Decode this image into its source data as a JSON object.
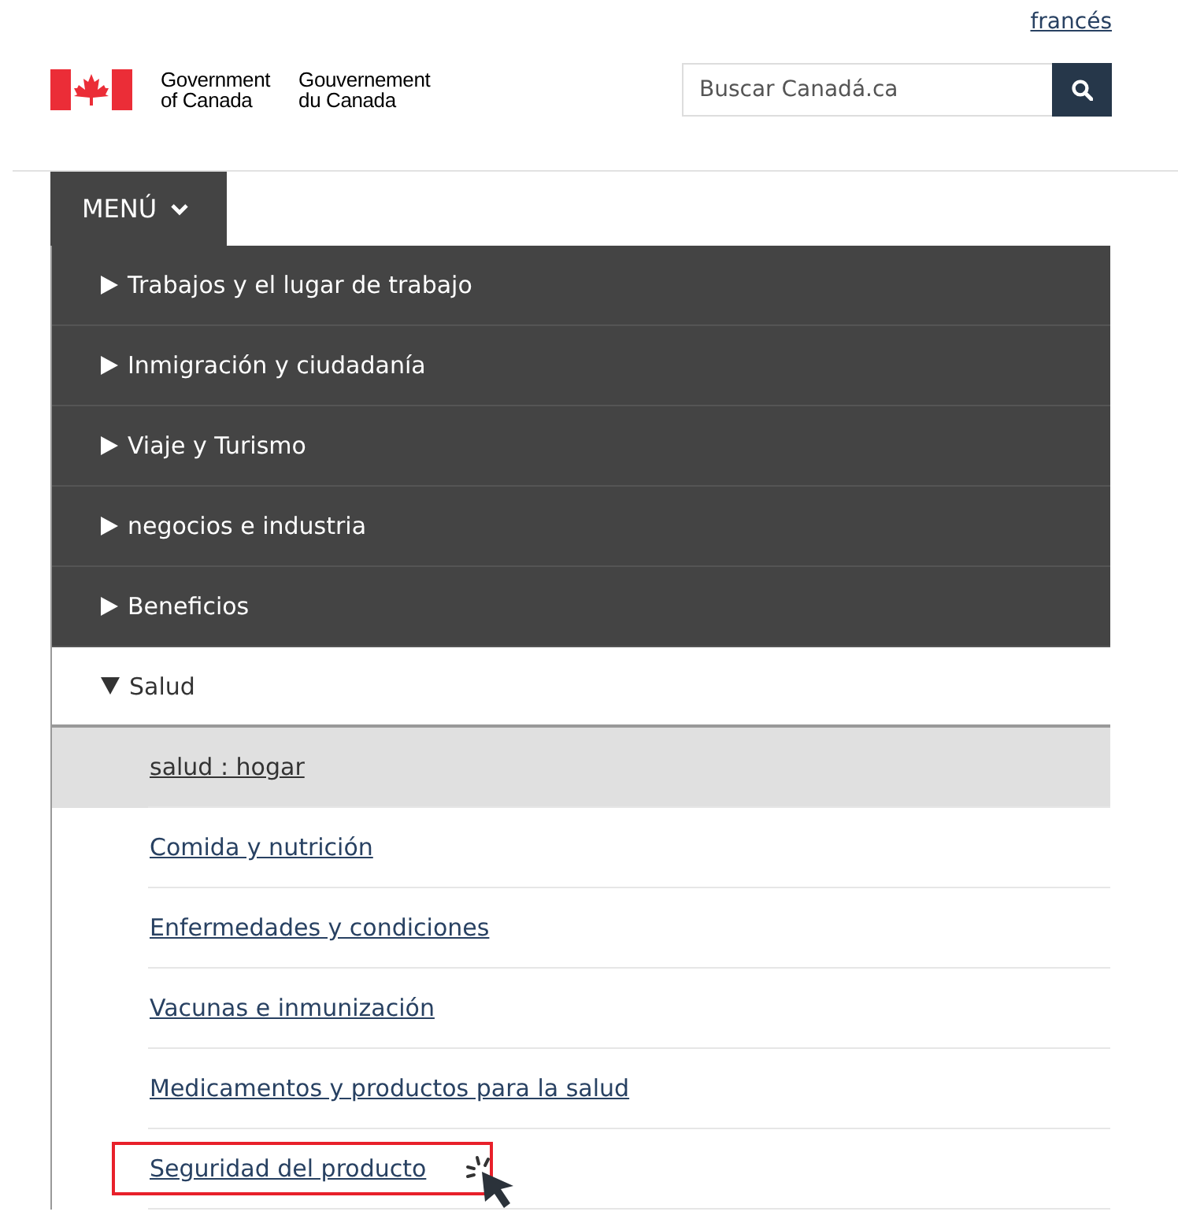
{
  "language_link": "francés",
  "brand": {
    "english": [
      "Government",
      "of Canada"
    ],
    "french": [
      "Gouvernement",
      "du Canada"
    ]
  },
  "search": {
    "placeholder": "Buscar Canadá.ca"
  },
  "menu": {
    "label": "MENÚ",
    "items": [
      {
        "label": "Trabajos y el lugar de trabajo",
        "expanded": false
      },
      {
        "label": "Inmigración y ciudadanía",
        "expanded": false
      },
      {
        "label": "Viaje y Turismo",
        "expanded": false
      },
      {
        "label": "negocios e industria",
        "expanded": false
      },
      {
        "label": "Beneficios",
        "expanded": false
      },
      {
        "label": "Salud",
        "expanded": true,
        "children": [
          {
            "label": "salud : hogar",
            "selected": true,
            "highlighted": false
          },
          {
            "label": "Comida y nutrición",
            "selected": false,
            "highlighted": false
          },
          {
            "label": "Enfermedades y condiciones",
            "selected": false,
            "highlighted": false
          },
          {
            "label": "Vacunas e inmunización",
            "selected": false,
            "highlighted": false
          },
          {
            "label": "Medicamentos y productos para la salud",
            "selected": false,
            "highlighted": false
          },
          {
            "label": "Seguridad del producto",
            "selected": false,
            "highlighted": true
          }
        ]
      }
    ]
  }
}
